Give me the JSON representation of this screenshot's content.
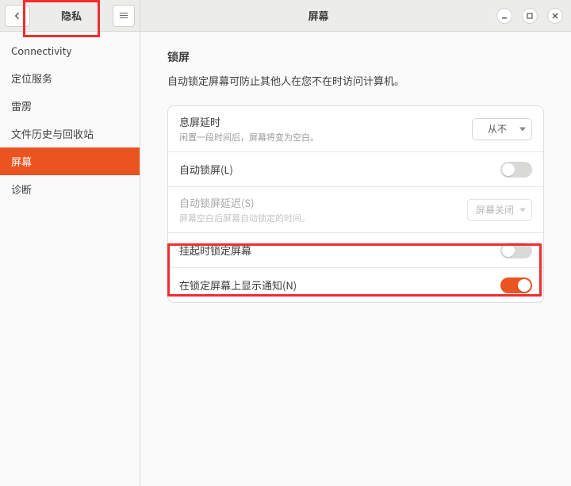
{
  "sidebar": {
    "title": "隐私",
    "items": [
      {
        "label": "Connectivity"
      },
      {
        "label": "定位服务"
      },
      {
        "label": "雷雳"
      },
      {
        "label": "文件历史与回收站"
      },
      {
        "label": "屏幕"
      },
      {
        "label": "诊断"
      }
    ],
    "selected_index": 4
  },
  "header": {
    "title": "屏幕"
  },
  "section": {
    "title": "锁屏",
    "desc": "自动锁定屏幕可防止其他人在您不在时访问计算机。"
  },
  "rows": {
    "blank_delay": {
      "label": "息屏延时",
      "sub": "闲置一段时间后，屏幕将变为空白。",
      "value": "从不"
    },
    "auto_lock": {
      "label": "自动锁屏(L)",
      "on": false
    },
    "lock_delay": {
      "label": "自动锁屏延迟(S)",
      "sub": "屏幕空白后屏幕自动锁定的时间。",
      "value": "屏幕关闭"
    },
    "suspend_lock": {
      "label": "挂起时锁定屏幕",
      "on": false
    },
    "notif_lock": {
      "label": "在锁定屏幕上显示通知(N)",
      "on": true
    }
  }
}
